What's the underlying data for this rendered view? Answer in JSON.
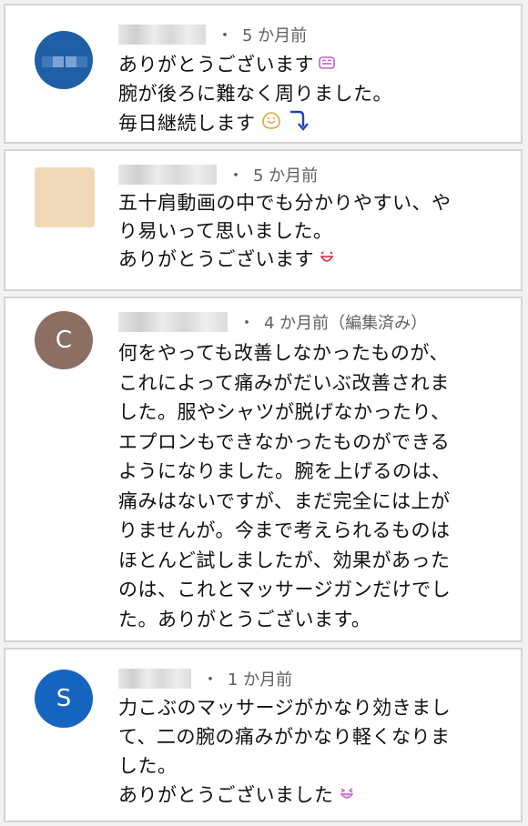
{
  "comments": [
    {
      "time": "5 か月前",
      "lines": [
        "ありがとうございます",
        "腕が後ろに難なく周りました。",
        "毎日継続します"
      ]
    },
    {
      "time": "5 か月前",
      "lines": [
        "五十肩動画の中でも分かりやすい、や",
        "り易いって思いました。",
        "ありがとうございます"
      ]
    },
    {
      "avatar_letter": "C",
      "time": "4 か月前（編集済み）",
      "lines": [
        "何をやっても改善しなかったものが、",
        "これによって痛みがだいぶ改善されま",
        "した。服やシャツが脱げなかったり、",
        "エプロンもできなかったものができる",
        "ようになりました。腕を上げるのは、",
        "痛みはないですが、まだ完全には上が",
        "りませんが。今まで考えられるものは",
        "ほとんど試しましたが、効果があった",
        "のは、これとマッサージガンだけでし",
        "た。ありがとうございます。"
      ]
    },
    {
      "avatar_letter": "S",
      "time": "1 か月前",
      "lines": [
        "力こぶのマッサージがかなり効きまし",
        "て、二の腕の痛みがかなり軽くなりま",
        "した。",
        "ありがとうございました"
      ]
    }
  ],
  "colors": {
    "avatar_c": "#8d6e63",
    "avatar_s": "#1565c0",
    "meta_text": "#606060"
  },
  "icons": [
    "grinning-emoji-icon",
    "folded-hands-emoji-icon",
    "curved-arrow-down-icon",
    "smiling-face-emoji-icon",
    "grinning-squinting-emoji-icon"
  ]
}
